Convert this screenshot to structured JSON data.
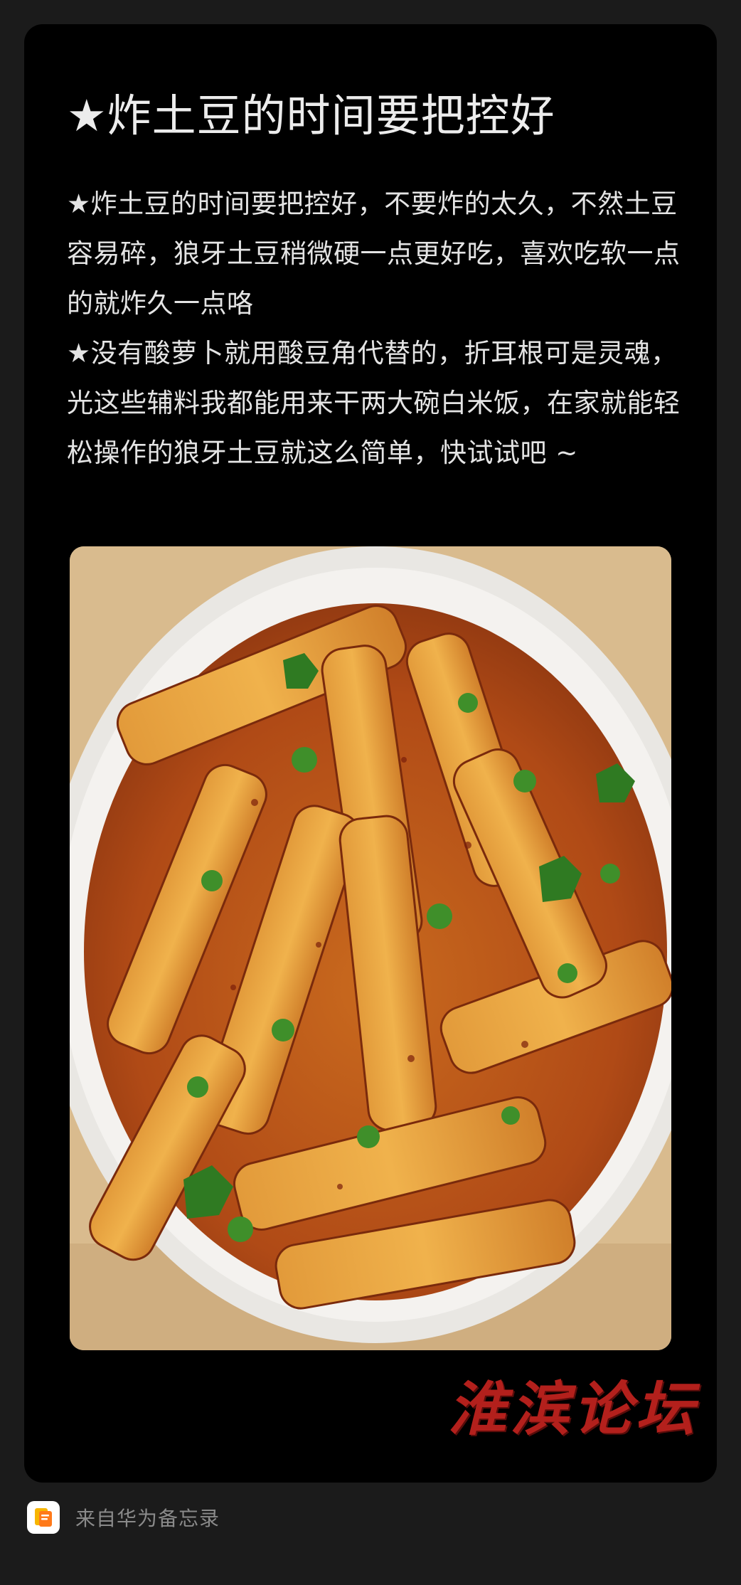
{
  "note": {
    "title": "★炸土豆的时间要把控好",
    "paragraphs": [
      "★炸土豆的时间要把控好，不要炸的太久，不然土豆容易碎，狼牙土豆稍微硬一点更好吃，喜欢吃软一点的就炸久一点咯",
      "★没有酸萝卜就用酸豆角代替的，折耳根可是灵魂，光这些辅料我都能用来干两大碗白米饭，在家就能轻松操作的狼牙土豆就这么简单，快试试吧 ~"
    ],
    "watermark": "淮滨论坛"
  },
  "footer": {
    "source_label": "来自华为备忘录",
    "icon": "notes-app-icon"
  },
  "colors": {
    "page_bg": "#1b1b1b",
    "card_bg": "#000000",
    "watermark": "#b3201c"
  }
}
